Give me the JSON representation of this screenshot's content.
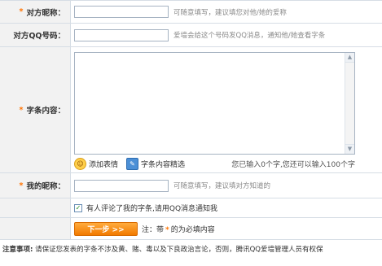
{
  "form": {
    "nickname_label": "对方昵称：",
    "nickname_hint": "可随意填写，建议填您对他/她的爱称",
    "qq_label": "对方QQ号码：",
    "qq_hint": "爱墙会给这个号码发QQ消息，通知他/她查看字条",
    "content_label": "字条内容：",
    "emoji_label": "添加表情",
    "template_label": "字条内容精选",
    "counter_text": "您已输入0个字,您还可以输入100个字",
    "my_nickname_label": "我的昵称：",
    "my_nickname_hint": "可随意填写，建议填对方知道的",
    "notify_checkbox_label": "有人评论了我的字条,请用QQ消息通知我",
    "notify_checked": true,
    "next_button_label": "下一步 >>",
    "required_prefix": "注：带",
    "required_star": "*",
    "required_suffix": "的为必填内容",
    "star": "*"
  },
  "notice": {
    "title": "注意事项:",
    "text": "请保证您发表的字条不涉及黄、赌、毒以及下良政治言论，否则，腾讯QQ爱墙管理人员有权保"
  },
  "colors": {
    "accent": "#ff7300",
    "border": "#d6dde5",
    "label_bg": "#f2f2f2"
  }
}
